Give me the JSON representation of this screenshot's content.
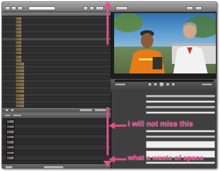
{
  "annotations": {
    "miss_text": "i will not miss this",
    "waste_text": "what a waste of space"
  },
  "colors": {
    "annotation": "#e23d8d",
    "window_bg": "#3c3c3c",
    "selection": "#4a4a4a"
  },
  "icons": {
    "close": "close-icon",
    "play": "play-icon",
    "arrow": "arrow-icon"
  }
}
